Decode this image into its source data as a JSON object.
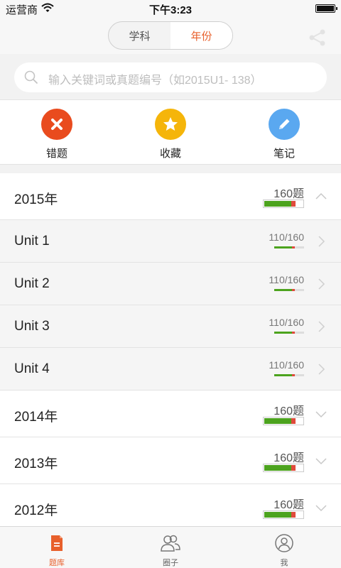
{
  "status_bar": {
    "carrier": "运营商",
    "time": "下午3:23"
  },
  "nav": {
    "segments": [
      {
        "label": "学科",
        "active": false
      },
      {
        "label": "年份",
        "active": true
      }
    ]
  },
  "search": {
    "placeholder": "输入关键词或真题编号（如2015U1- 138）"
  },
  "quick_actions": [
    {
      "label": "错题",
      "icon": "close-icon",
      "color": "#e94b1e"
    },
    {
      "label": "收藏",
      "icon": "star-icon",
      "color": "#f5b50a"
    },
    {
      "label": "笔记",
      "icon": "pencil-icon",
      "color": "#5aa8f0"
    }
  ],
  "list": {
    "years": [
      {
        "label": "2015年",
        "count": "160题",
        "green": 0.68,
        "red": 0.1,
        "expanded": true,
        "units": [
          {
            "label": "Unit 1",
            "count": "110/160",
            "green": 0.6,
            "red": 0.1
          },
          {
            "label": "Unit 2",
            "count": "110/160",
            "green": 0.6,
            "red": 0.1
          },
          {
            "label": "Unit 3",
            "count": "110/160",
            "green": 0.6,
            "red": 0.1
          },
          {
            "label": "Unit 4",
            "count": "110/160",
            "green": 0.6,
            "red": 0.1
          }
        ]
      },
      {
        "label": "2014年",
        "count": "160题",
        "green": 0.68,
        "red": 0.1,
        "expanded": false,
        "units": []
      },
      {
        "label": "2013年",
        "count": "160题",
        "green": 0.68,
        "red": 0.1,
        "expanded": false,
        "units": []
      },
      {
        "label": "2012年",
        "count": "160题",
        "green": 0.68,
        "red": 0.1,
        "expanded": false,
        "units": []
      }
    ]
  },
  "tab_bar": [
    {
      "label": "题库",
      "icon": "question-bank-icon",
      "active": true
    },
    {
      "label": "圈子",
      "icon": "group-icon",
      "active": false
    },
    {
      "label": "我",
      "icon": "profile-icon",
      "active": false
    }
  ],
  "colors": {
    "accent": "#e8602c",
    "progress_green": "#4ca31e",
    "progress_red": "#e04a3c"
  }
}
